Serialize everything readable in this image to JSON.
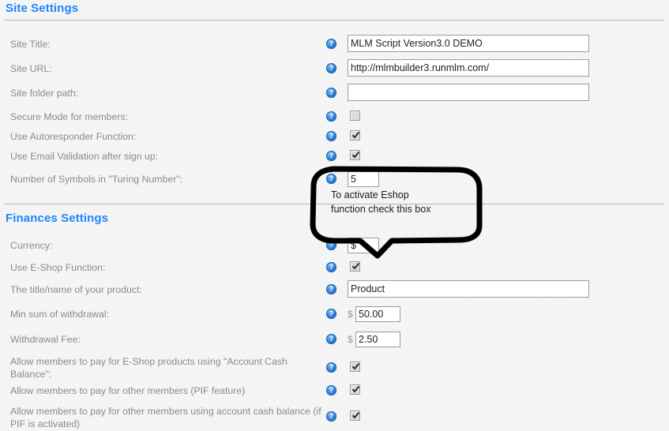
{
  "sections": [
    {
      "title": "Site Settings",
      "rows": [
        {
          "label": "Site Title:",
          "help": "?",
          "control": "text",
          "value": "MLM Script Version3.0 DEMO"
        },
        {
          "label": "Site URL:",
          "help": "?",
          "control": "text",
          "value": "http://mlmbuilder3.runmlm.com/"
        },
        {
          "label": "Site folder path:",
          "help": "?",
          "control": "text",
          "value": ""
        },
        {
          "label": "Secure Mode for members:",
          "help": "?",
          "control": "checkbox",
          "checked": false
        },
        {
          "label": "Use Autoresponder Function:",
          "help": "?",
          "control": "checkbox",
          "checked": true
        },
        {
          "label": "Use Email Validation after sign up:",
          "help": "?",
          "control": "checkbox",
          "checked": true
        },
        {
          "label": "Number of Symbols in \"Turing Number\":",
          "help": "?",
          "control": "tiny",
          "value": "5"
        }
      ]
    },
    {
      "title": "Finances Settings",
      "rows": [
        {
          "label": "Currency:",
          "help": "?",
          "control": "tiny",
          "value": "$"
        },
        {
          "label": "Use E-Shop Function:",
          "help": "?",
          "control": "checkbox",
          "checked": true
        },
        {
          "label": "The title/name of your product:",
          "help": "?",
          "control": "text",
          "value": "Product"
        },
        {
          "label": "Min sum of withdrawal:",
          "help": "?",
          "control": "money",
          "prefix": "$",
          "value": "50.00"
        },
        {
          "label": "Withdrawal Fee:",
          "help": "?",
          "control": "money",
          "prefix": "$",
          "value": "2.50"
        },
        {
          "label": "Allow members to pay for E-Shop products using \"Account Cash Balance\":",
          "help": "?",
          "control": "checkbox",
          "checked": true
        },
        {
          "label": "Allow members to pay for other members (PIF feature)",
          "help": "?",
          "control": "checkbox",
          "checked": true
        },
        {
          "label": "Allow members to pay for other members using account cash balance (if PIF is activated)",
          "help": "?",
          "control": "checkbox",
          "checked": true
        }
      ]
    }
  ],
  "annotation": {
    "text": "To activate Eshop function check this box",
    "line1": "To activate Eshop",
    "line2": "function check this box",
    "stroke_color": "#000000"
  },
  "colors": {
    "heading": "#1e85ff",
    "label": "#8a8a8a",
    "background": "#f5f5f5",
    "divider": "#b6b6b6",
    "help_icon": "#2f7fd8"
  }
}
